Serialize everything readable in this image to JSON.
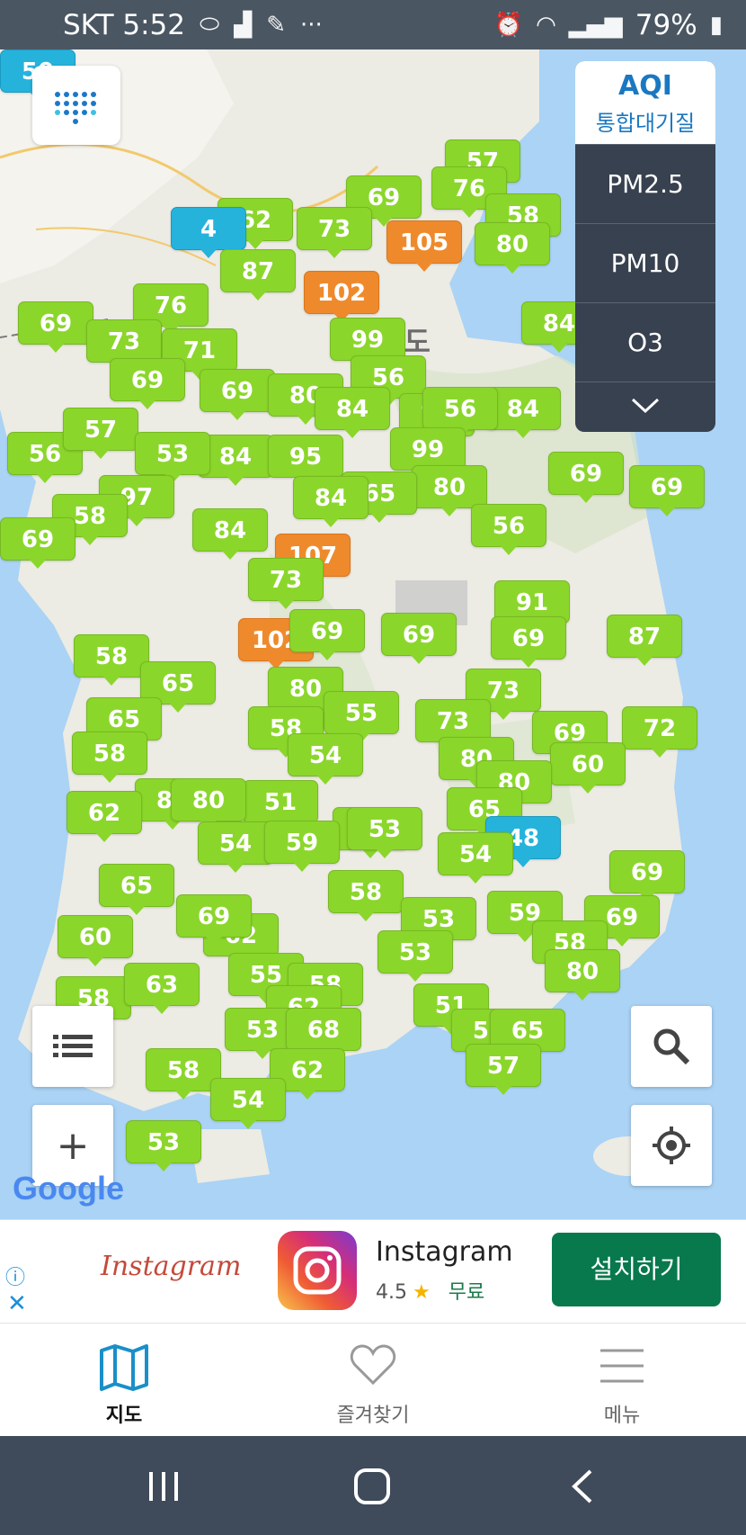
{
  "status_bar": {
    "carrier_time": "SKT 5:52",
    "battery": "79%",
    "icons": [
      "pill-icon",
      "upload-icon",
      "feather-icon",
      "more-dots-icon",
      "alarm-icon",
      "wifi-icon",
      "signal-icon",
      "battery-icon"
    ]
  },
  "panel": {
    "aqi_title": "AQI",
    "aqi_subtitle": "통합대기질",
    "options": [
      "PM2.5",
      "PM10",
      "O3"
    ]
  },
  "map": {
    "place_label": "원도",
    "attribution": "Google",
    "colors": {
      "good": "#8bd62b",
      "moderate": "#ef8a2c",
      "low": "#25b3dc",
      "sea": "#aad3f5",
      "land": "#ecebe4"
    },
    "markers": [
      {
        "value": "57",
        "level": "good"
      },
      {
        "value": "76",
        "level": "good"
      },
      {
        "value": "69",
        "level": "good"
      },
      {
        "value": "58",
        "level": "good"
      },
      {
        "value": "80",
        "level": "good"
      },
      {
        "value": "105",
        "level": "moderate"
      },
      {
        "value": "62",
        "level": "good"
      },
      {
        "value": "73",
        "level": "good"
      },
      {
        "value": "4",
        "level": "low"
      },
      {
        "value": "87",
        "level": "good"
      },
      {
        "value": "102",
        "level": "moderate"
      },
      {
        "value": "76",
        "level": "good"
      },
      {
        "value": "69",
        "level": "good"
      },
      {
        "value": "73",
        "level": "good"
      },
      {
        "value": "99",
        "level": "good"
      },
      {
        "value": "71",
        "level": "good"
      },
      {
        "value": "84",
        "level": "good"
      },
      {
        "value": "69",
        "level": "good"
      },
      {
        "value": "56",
        "level": "good"
      },
      {
        "value": "69",
        "level": "good"
      },
      {
        "value": "80",
        "level": "good"
      },
      {
        "value": "56",
        "level": "good"
      },
      {
        "value": "84",
        "level": "good"
      },
      {
        "value": "76",
        "level": "good"
      },
      {
        "value": "84",
        "level": "good"
      },
      {
        "value": "56",
        "level": "good"
      },
      {
        "value": "57",
        "level": "good"
      },
      {
        "value": "84",
        "level": "good"
      },
      {
        "value": "95",
        "level": "good"
      },
      {
        "value": "53",
        "level": "good"
      },
      {
        "value": "99",
        "level": "good"
      },
      {
        "value": "80",
        "level": "good"
      },
      {
        "value": "65",
        "level": "good"
      },
      {
        "value": "69",
        "level": "good"
      },
      {
        "value": "97",
        "level": "good"
      },
      {
        "value": "84",
        "level": "good"
      },
      {
        "value": "58",
        "level": "good"
      },
      {
        "value": "84",
        "level": "good"
      },
      {
        "value": "107",
        "level": "moderate"
      },
      {
        "value": "56",
        "level": "good"
      },
      {
        "value": "69",
        "level": "good"
      },
      {
        "value": "69",
        "level": "good"
      },
      {
        "value": "73",
        "level": "good"
      },
      {
        "value": "91",
        "level": "good"
      },
      {
        "value": "102",
        "level": "moderate"
      },
      {
        "value": "69",
        "level": "good"
      },
      {
        "value": "58",
        "level": "good"
      },
      {
        "value": "69",
        "level": "good"
      },
      {
        "value": "87",
        "level": "good"
      },
      {
        "value": "65",
        "level": "good"
      },
      {
        "value": "80",
        "level": "good"
      },
      {
        "value": "69",
        "level": "good"
      },
      {
        "value": "73",
        "level": "good"
      },
      {
        "value": "65",
        "level": "good"
      },
      {
        "value": "58",
        "level": "good"
      },
      {
        "value": "55",
        "level": "good"
      },
      {
        "value": "73",
        "level": "good"
      },
      {
        "value": "69",
        "level": "good"
      },
      {
        "value": "72",
        "level": "good"
      },
      {
        "value": "58",
        "level": "good"
      },
      {
        "value": "54",
        "level": "good"
      },
      {
        "value": "80",
        "level": "good"
      },
      {
        "value": "60",
        "level": "good"
      },
      {
        "value": "84",
        "level": "good"
      },
      {
        "value": "80",
        "level": "good"
      },
      {
        "value": "62",
        "level": "good"
      },
      {
        "value": "51",
        "level": "good"
      },
      {
        "value": "80",
        "level": "good"
      },
      {
        "value": "54",
        "level": "good"
      },
      {
        "value": "65",
        "level": "good"
      },
      {
        "value": "48",
        "level": "low"
      },
      {
        "value": "54",
        "level": "good"
      },
      {
        "value": "59",
        "level": "good"
      },
      {
        "value": "53",
        "level": "good"
      },
      {
        "value": "54",
        "level": "good"
      },
      {
        "value": "69",
        "level": "good"
      },
      {
        "value": "65",
        "level": "good"
      },
      {
        "value": "69",
        "level": "good"
      },
      {
        "value": "58",
        "level": "good"
      },
      {
        "value": "59",
        "level": "good"
      },
      {
        "value": "60",
        "level": "good"
      },
      {
        "value": "62",
        "level": "good"
      },
      {
        "value": "53",
        "level": "good"
      },
      {
        "value": "69",
        "level": "good"
      },
      {
        "value": "55",
        "level": "good"
      },
      {
        "value": "53",
        "level": "good"
      },
      {
        "value": "58",
        "level": "good"
      },
      {
        "value": "58",
        "level": "good"
      },
      {
        "value": "63",
        "level": "good"
      },
      {
        "value": "58",
        "level": "good"
      },
      {
        "value": "80",
        "level": "good"
      },
      {
        "value": "62",
        "level": "good"
      },
      {
        "value": "51",
        "level": "good"
      },
      {
        "value": "55",
        "level": "good"
      },
      {
        "value": "65",
        "level": "good"
      },
      {
        "value": "53",
        "level": "good"
      },
      {
        "value": "68",
        "level": "good"
      },
      {
        "value": "58",
        "level": "good"
      },
      {
        "value": "62",
        "level": "good"
      },
      {
        "value": "57",
        "level": "good"
      },
      {
        "value": "54",
        "level": "good"
      },
      {
        "value": "53",
        "level": "good"
      },
      {
        "value": "50",
        "level": "low"
      }
    ]
  },
  "controls": {
    "list": "list-icon",
    "zoom_in": "+",
    "search": "search-icon",
    "locate": "locate-icon"
  },
  "ad": {
    "brand_text": "Instagram",
    "app_name": "Instagram",
    "rating": "4.5",
    "price": "무료",
    "install_label": "설치하기"
  },
  "nav": {
    "tabs": [
      {
        "label": "지도",
        "icon": "map-icon"
      },
      {
        "label": "즐겨찾기",
        "icon": "heart-icon"
      },
      {
        "label": "메뉴",
        "icon": "menu-icon"
      }
    ]
  }
}
